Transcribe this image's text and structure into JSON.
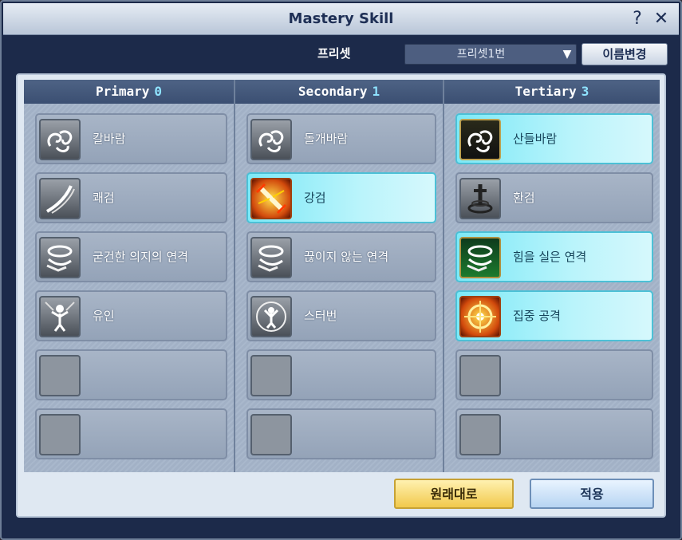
{
  "window": {
    "title": "Mastery Skill",
    "help_label": "?",
    "close_label": "✕"
  },
  "preset": {
    "label": "프리셋",
    "selected": "프리셋1번",
    "arrow": "▼",
    "rename_label": "이름변경"
  },
  "columns": [
    {
      "name": "Primary",
      "count": "0",
      "slots": [
        {
          "name": "칼바람",
          "icon": "swirl-wind-icon",
          "active": false
        },
        {
          "name": "쾌검",
          "icon": "blade-slash-icon",
          "active": false
        },
        {
          "name": "굳건한 의지의 연격",
          "icon": "hand-vortex-icon",
          "active": false
        },
        {
          "name": "유인",
          "icon": "lure-figure-icon",
          "active": false
        },
        {
          "name": "",
          "icon": "empty-slot-icon",
          "active": false
        },
        {
          "name": "",
          "icon": "empty-slot-icon",
          "active": false
        }
      ]
    },
    {
      "name": "Secondary",
      "count": "1",
      "slots": [
        {
          "name": "돌개바람",
          "icon": "swirl-wind-icon",
          "active": false
        },
        {
          "name": "강검",
          "icon": "power-sword-icon",
          "active": true
        },
        {
          "name": "끊이지 않는 연격",
          "icon": "hand-vortex-icon",
          "active": false
        },
        {
          "name": "스터번",
          "icon": "stubborn-figure-icon",
          "active": false
        },
        {
          "name": "",
          "icon": "empty-slot-icon",
          "active": false
        },
        {
          "name": "",
          "icon": "empty-slot-icon",
          "active": false
        }
      ]
    },
    {
      "name": "Tertiary",
      "count": "3",
      "slots": [
        {
          "name": "산들바람",
          "icon": "swirl-wind-icon",
          "active": true
        },
        {
          "name": "환검",
          "icon": "sword-pedestal-icon",
          "active": false
        },
        {
          "name": "힘을 실은 연격",
          "icon": "hand-vortex-icon",
          "active": true
        },
        {
          "name": "집중 공격",
          "icon": "target-focus-icon",
          "active": true
        },
        {
          "name": "",
          "icon": "empty-slot-icon",
          "active": false
        },
        {
          "name": "",
          "icon": "empty-slot-icon",
          "active": false
        }
      ]
    }
  ],
  "footer": {
    "reset_label": "원래대로",
    "apply_label": "적용"
  }
}
